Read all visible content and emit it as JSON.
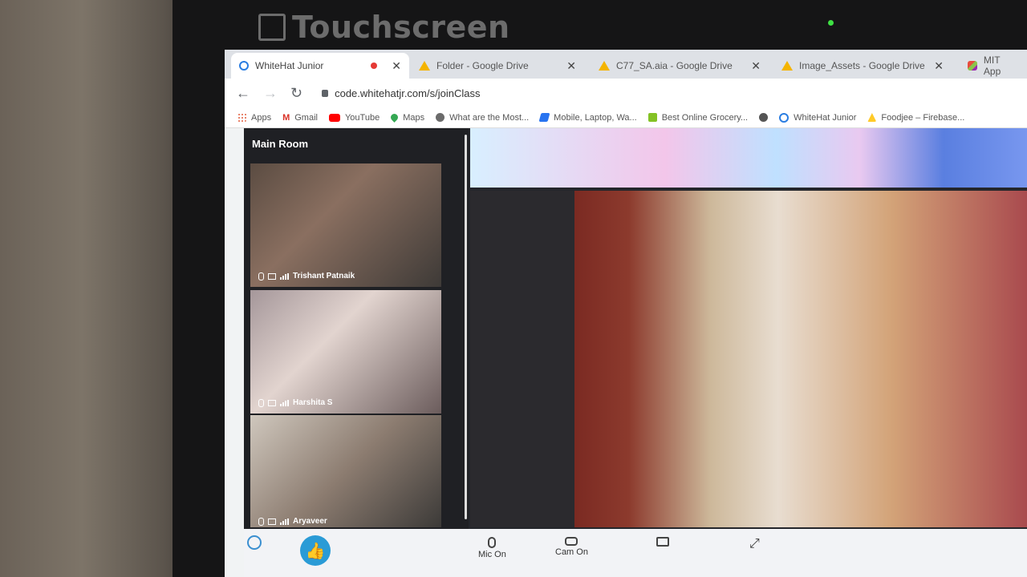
{
  "bezel": {
    "label": "Touchscreen"
  },
  "browser": {
    "tabs": [
      {
        "title": "WhiteHat Junior",
        "icon": "whitehat-icon",
        "recording": true
      },
      {
        "title": "Folder - Google Drive",
        "icon": "google-drive-icon"
      },
      {
        "title": "C77_SA.aia - Google Drive",
        "icon": "google-drive-icon"
      },
      {
        "title": "Image_Assets - Google Drive",
        "icon": "google-drive-icon"
      },
      {
        "title": "MIT App",
        "icon": "mit-app-icon"
      }
    ],
    "url": "code.whitehatjr.com/s/joinClass",
    "bookmarks": [
      {
        "label": "Apps",
        "icon": "apps-grid-icon",
        "color": "#e25c3c"
      },
      {
        "label": "Gmail",
        "icon": "gmail-icon",
        "color": "#d93025"
      },
      {
        "label": "YouTube",
        "icon": "youtube-icon",
        "color": "#ff0000"
      },
      {
        "label": "Maps",
        "icon": "maps-icon",
        "color": "#34a853"
      },
      {
        "label": "What are the Most...",
        "icon": "globe-icon",
        "color": "#6b6b6b"
      },
      {
        "label": "Mobile, Laptop, Wa...",
        "icon": "flipkart-icon",
        "color": "#2874f0"
      },
      {
        "label": "Best Online Grocery...",
        "icon": "bigbasket-icon",
        "color": "#84c225"
      },
      {
        "label": "",
        "icon": "globe-icon",
        "color": "#555555"
      },
      {
        "label": "WhiteHat Junior",
        "icon": "whitehat-icon",
        "color": "#2a7de1"
      },
      {
        "label": "Foodjee – Firebase...",
        "icon": "firebase-icon",
        "color": "#ffca28"
      }
    ]
  },
  "classroom": {
    "room_title": "Main Room",
    "participants": [
      {
        "name": "Trishant Patnaik"
      },
      {
        "name": "Harshita S"
      },
      {
        "name": "Aryaveer"
      }
    ],
    "controls": [
      {
        "label": "Mic On",
        "icon": "mic-icon"
      },
      {
        "label": "Cam On",
        "icon": "camera-icon"
      },
      {
        "label": "",
        "icon": "screen-share-icon"
      },
      {
        "label": "",
        "icon": "fullscreen-icon"
      }
    ]
  }
}
